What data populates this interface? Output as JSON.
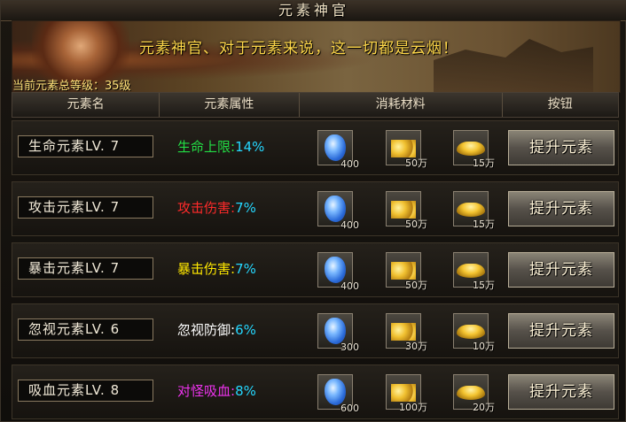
{
  "window": {
    "title": "元素神官"
  },
  "banner": {
    "slogan": "元素神官、对于元素来说，这一切都是云烟！",
    "total_label": "当前元素总等级：",
    "total_value": "35级"
  },
  "header": {
    "columns": [
      "元素名",
      "元素属性",
      "消耗材料",
      "按钮"
    ]
  },
  "rows": [
    {
      "name": "生命元素LV. 7",
      "attr_label": "生命上限:",
      "attr_value": "14%",
      "attr_color": "#22dd44",
      "materials": [
        {
          "icon": "blue-gem-icon",
          "count": "400"
        },
        {
          "icon": "gold-coins-icon",
          "count": "50万"
        },
        {
          "icon": "gold-ingot-icon",
          "count": "15万"
        }
      ],
      "button": "提升元素"
    },
    {
      "name": "攻击元素LV. 7",
      "attr_label": "攻击伤害:",
      "attr_value": "7%",
      "attr_color": "#ff2a2a",
      "materials": [
        {
          "icon": "blue-gem-icon",
          "count": "400"
        },
        {
          "icon": "gold-coins-icon",
          "count": "50万"
        },
        {
          "icon": "gold-ingot-icon",
          "count": "15万"
        }
      ],
      "button": "提升元素"
    },
    {
      "name": "暴击元素LV. 7",
      "attr_label": "暴击伤害:",
      "attr_value": "7%",
      "attr_color": "#ffe800",
      "materials": [
        {
          "icon": "blue-gem-icon",
          "count": "400"
        },
        {
          "icon": "gold-coins-icon",
          "count": "50万"
        },
        {
          "icon": "gold-ingot-icon",
          "count": "15万"
        }
      ],
      "button": "提升元素"
    },
    {
      "name": "忽视元素LV. 6",
      "attr_label": "忽视防御:",
      "attr_value": "6%",
      "attr_color": "#ffffff",
      "materials": [
        {
          "icon": "blue-gem-icon",
          "count": "300"
        },
        {
          "icon": "gold-coins-icon",
          "count": "30万"
        },
        {
          "icon": "gold-ingot-icon",
          "count": "10万"
        }
      ],
      "button": "提升元素"
    },
    {
      "name": "吸血元素LV. 8",
      "attr_label": "对怪吸血:",
      "attr_value": "8%",
      "attr_color": "#ee33ee",
      "materials": [
        {
          "icon": "blue-gem-icon",
          "count": "600"
        },
        {
          "icon": "gold-coins-icon",
          "count": "100万"
        },
        {
          "icon": "gold-ingot-icon",
          "count": "20万"
        }
      ],
      "button": "提升元素"
    }
  ],
  "colors": {
    "attr_value": "#25d7ff",
    "slogan": "#ffd84a",
    "gem": "#2a6ad8",
    "gold": "#f0c030"
  }
}
